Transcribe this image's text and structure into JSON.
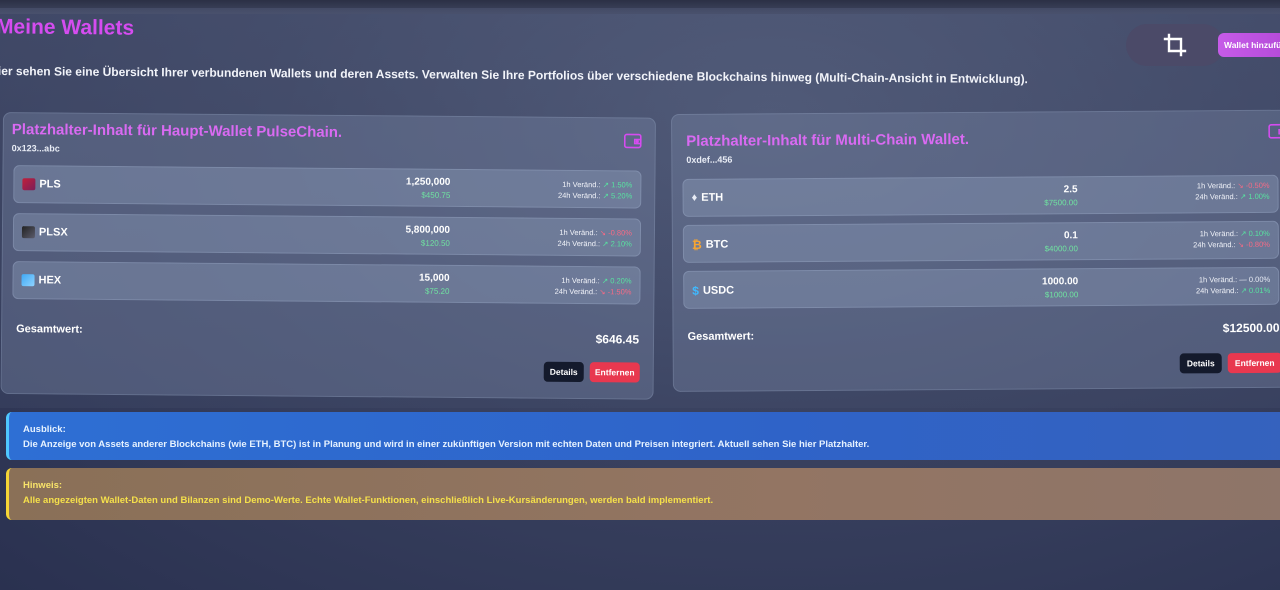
{
  "header": {
    "title": "Meine Wallets",
    "description": "ier sehen Sie eine Übersicht Ihrer verbundenen Wallets und deren Assets. Verwalten Sie Ihre Portfolios über verschiedene Blockchains hinweg (Multi-Chain-Ansicht in Entwicklung).",
    "add_wallet_label": "Wallet hinzufüg"
  },
  "wallets": [
    {
      "title": "Platzhalter-Inhalt für Haupt-Wallet PulseChain.",
      "address": "0x123...abc",
      "assets": [
        {
          "name": "PLS",
          "amount": "1,250,000",
          "usd": "$450.75",
          "h1_label": "1h Veränd.:",
          "h1_arrow": "↗",
          "h1": "1.50%",
          "h24_label": "24h Veränd.:",
          "h24_arrow": "↗",
          "h24": "5.20%"
        },
        {
          "name": "PLSX",
          "amount": "5,800,000",
          "usd": "$120.50",
          "h1_label": "1h Veränd.:",
          "h1_arrow": "↘",
          "h1": "-0.80%",
          "h24_label": "24h Veränd.:",
          "h24_arrow": "↗",
          "h24": "2.10%"
        },
        {
          "name": "HEX",
          "amount": "15,000",
          "usd": "$75.20",
          "h1_label": "1h Veränd.:",
          "h1_arrow": "↗",
          "h1": "0.20%",
          "h24_label": "24h Veränd.:",
          "h24_arrow": "↘",
          "h24": "-1.50%"
        }
      ],
      "total_label": "Gesamtwert:",
      "total_value": "$646.45",
      "details_label": "Details",
      "remove_label": "Entfernen"
    },
    {
      "title": "Platzhalter-Inhalt für Multi-Chain Wallet.",
      "address": "0xdef...456",
      "assets": [
        {
          "name": "ETH",
          "amount": "2.5",
          "usd": "$7500.00",
          "h1_label": "1h Veränd.:",
          "h1_arrow": "↘",
          "h1": "-0.50%",
          "h24_label": "24h Veränd.:",
          "h24_arrow": "↗",
          "h24": "1.00%"
        },
        {
          "name": "BTC",
          "amount": "0.1",
          "usd": "$4000.00",
          "h1_label": "1h Veränd.:",
          "h1_arrow": "↗",
          "h1": "0.10%",
          "h24_label": "24h Veränd.:",
          "h24_arrow": "↘",
          "h24": "-0.80%"
        },
        {
          "name": "USDC",
          "amount": "1000.00",
          "usd": "$1000.00",
          "h1_label": "1h Veränd.:",
          "h1_arrow": "—",
          "h1": "0.00%",
          "h24_label": "24h Veränd.:",
          "h24_arrow": "↗",
          "h24": "0.01%"
        }
      ],
      "total_label": "Gesamtwert:",
      "total_value": "$12500.00",
      "details_label": "Details",
      "remove_label": "Entfernen"
    }
  ],
  "notices": {
    "outlook_title": "Ausblick:",
    "outlook_text": "Die Anzeige von Assets anderer Blockchains (wie ETH, BTC) ist in Planung und wird in einer zukünftigen Version mit echten Daten und Preisen integriert. Aktuell sehen Sie hier Platzhalter.",
    "hint_title": "Hinweis:",
    "hint_text": "Alle angezeigten Wallet-Daten und Bilanzen sind Demo-Werte. Echte Wallet-Funktionen, einschließlich Live-Kursänderungen, werden bald implementiert."
  },
  "colors": {
    "accent": "#d54cf0",
    "positive": "#58e2a0",
    "negative": "#f76a85",
    "remove_button": "#e8384f",
    "details_button": "#141a2c"
  },
  "icons": {
    "crop": "crop-icon",
    "wallet": "wallet-icon",
    "eth": "ethereum-icon",
    "btc": "bitcoin-icon",
    "usdc": "dollar-icon"
  }
}
